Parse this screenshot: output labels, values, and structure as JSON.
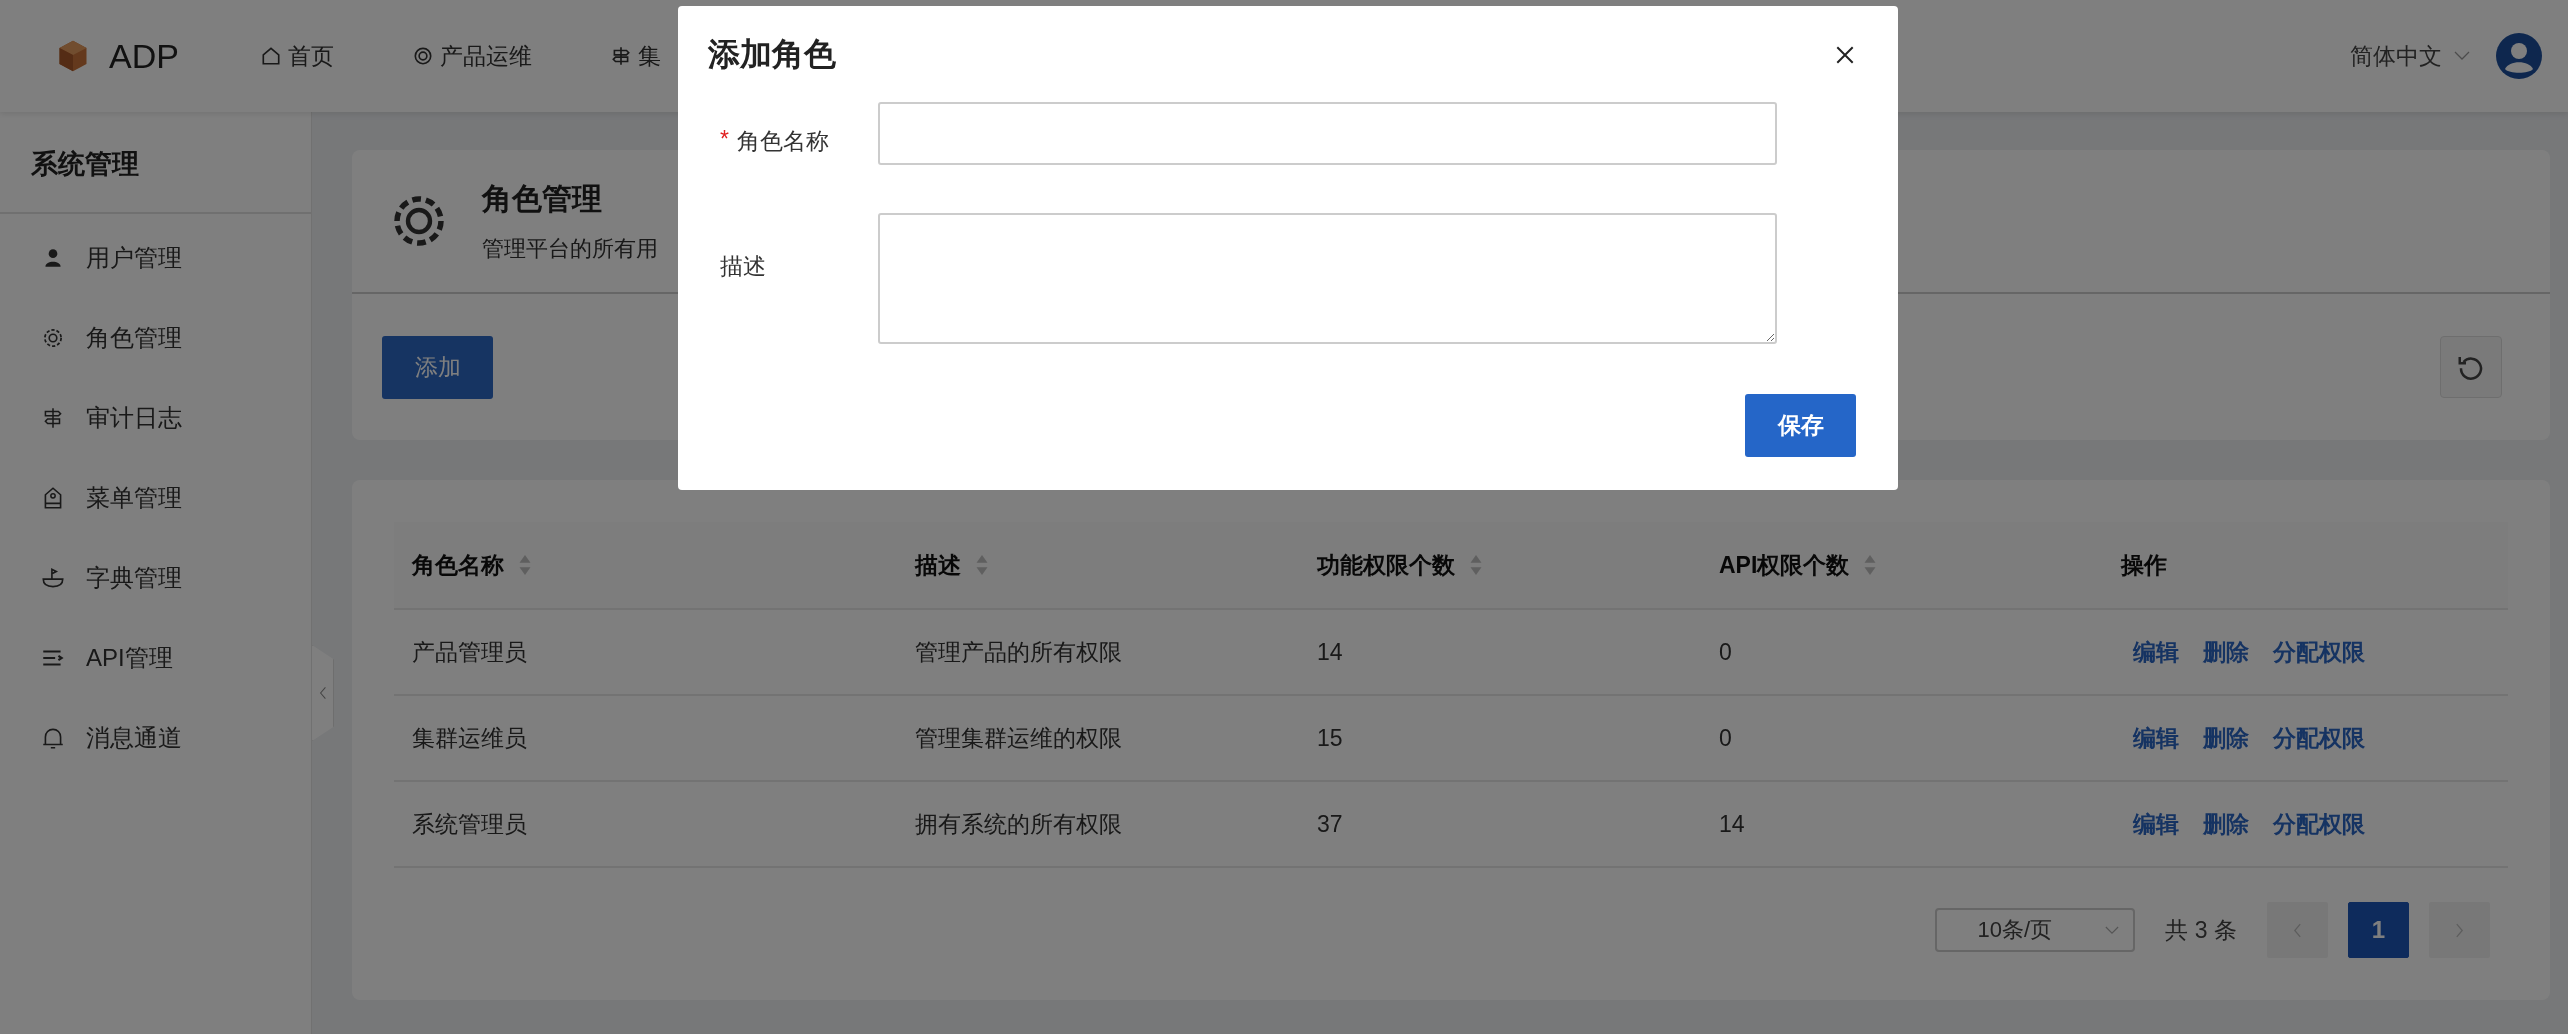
{
  "header": {
    "logo_text": "ADP",
    "nav": [
      {
        "label": "首页"
      },
      {
        "label": "产品运维"
      },
      {
        "label": "集"
      }
    ],
    "language": "简体中文"
  },
  "sidebar": {
    "title": "系统管理",
    "items": [
      {
        "label": "用户管理"
      },
      {
        "label": "角色管理"
      },
      {
        "label": "审计日志"
      },
      {
        "label": "菜单管理"
      },
      {
        "label": "字典管理"
      },
      {
        "label": "API管理"
      },
      {
        "label": "消息通道"
      }
    ]
  },
  "page_header": {
    "title": "角色管理",
    "subtitle": "管理平台的所有用"
  },
  "toolbar": {
    "add_button": "添加"
  },
  "table": {
    "columns": [
      {
        "label": "角色名称",
        "sortable": true
      },
      {
        "label": "描述",
        "sortable": true
      },
      {
        "label": "功能权限个数",
        "sortable": true
      },
      {
        "label": "API权限个数",
        "sortable": true
      },
      {
        "label": "操作",
        "sortable": false
      }
    ],
    "rows": [
      {
        "cells": [
          "产品管理员",
          "管理产品的所有权限",
          "14",
          "0"
        ],
        "actions": [
          "编辑",
          "删除",
          "分配权限"
        ]
      },
      {
        "cells": [
          "集群运维员",
          "管理集群运维的权限",
          "15",
          "0"
        ],
        "actions": [
          "编辑",
          "删除",
          "分配权限"
        ]
      },
      {
        "cells": [
          "系统管理员",
          "拥有系统的所有权限",
          "37",
          "14"
        ],
        "actions": [
          "编辑",
          "删除",
          "分配权限"
        ]
      }
    ]
  },
  "pagination": {
    "page_size": "10条/页",
    "total": "共 3 条",
    "prev_disabled": true,
    "next_disabled": true,
    "pages": [
      {
        "label": "1",
        "selected": true
      }
    ]
  },
  "dialog": {
    "title": "添加角色",
    "fields": [
      {
        "label": "角色名称",
        "required_mark": "*",
        "kind": "input"
      },
      {
        "label": "描述",
        "kind": "textarea"
      }
    ],
    "save_button": "保存"
  }
}
